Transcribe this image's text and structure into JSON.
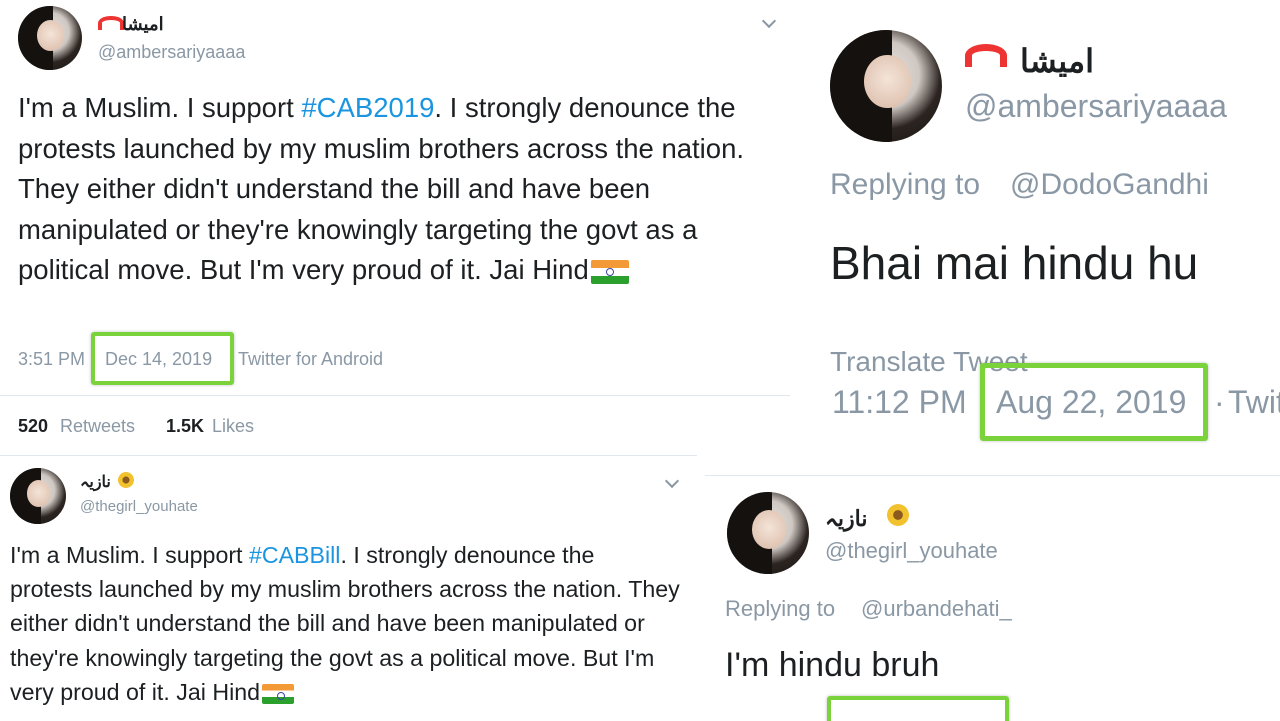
{
  "tweet1": {
    "name": "امیشا",
    "handle": "@ambersariyaaaa",
    "text_before": "I'm a Muslim. I support ",
    "hashtag": "#CAB2019",
    "text_after": ". I strongly denounce the protests launched by my muslim brothers across the nation. They either didn't understand the bill and have been manipulated or they're knowingly targeting the govt as a political move. But I'm very proud of it. Jai Hind",
    "time": "3:51 PM",
    "date": "Dec 14, 2019",
    "source": "Twitter for Android",
    "retweets_count": "520",
    "retweets_label": "Retweets",
    "likes_count": "1.5K",
    "likes_label": "Likes"
  },
  "tweet2": {
    "name": "امیشا",
    "handle": "@ambersariyaaaa",
    "replying_label": "Replying to",
    "replying_to": "@DodoGandhi",
    "text": "Bhai mai hindu hu",
    "translate": "Translate Tweet",
    "time": "11:12 PM",
    "date": "Aug 22, 2019",
    "source": "Twit"
  },
  "tweet3": {
    "name": "نازیہ",
    "handle": "@thegirl_youhate",
    "text_before": "I'm a Muslim. I support ",
    "hashtag": "#CABBill",
    "text_after": ". I strongly denounce the protests launched by my muslim brothers across the nation. They either didn't understand the bill and have been manipulated or they're knowingly targeting the govt as a political move. But I'm very proud of it. Jai Hind"
  },
  "tweet4": {
    "name": "نازیہ",
    "handle": "@thegirl_youhate",
    "replying_label": "Replying to",
    "replying_to": "@urbandehati_",
    "text": "I'm hindu bruh"
  },
  "colors": {
    "link": "#1b95e0",
    "highlight": "#7ad33b",
    "muted": "#8a98a5",
    "text": "#1c2022"
  },
  "icons": [
    "rainbow-emoji-icon",
    "india-flag-emoji-icon",
    "sunflower-emoji-icon",
    "chevron-down-icon"
  ]
}
